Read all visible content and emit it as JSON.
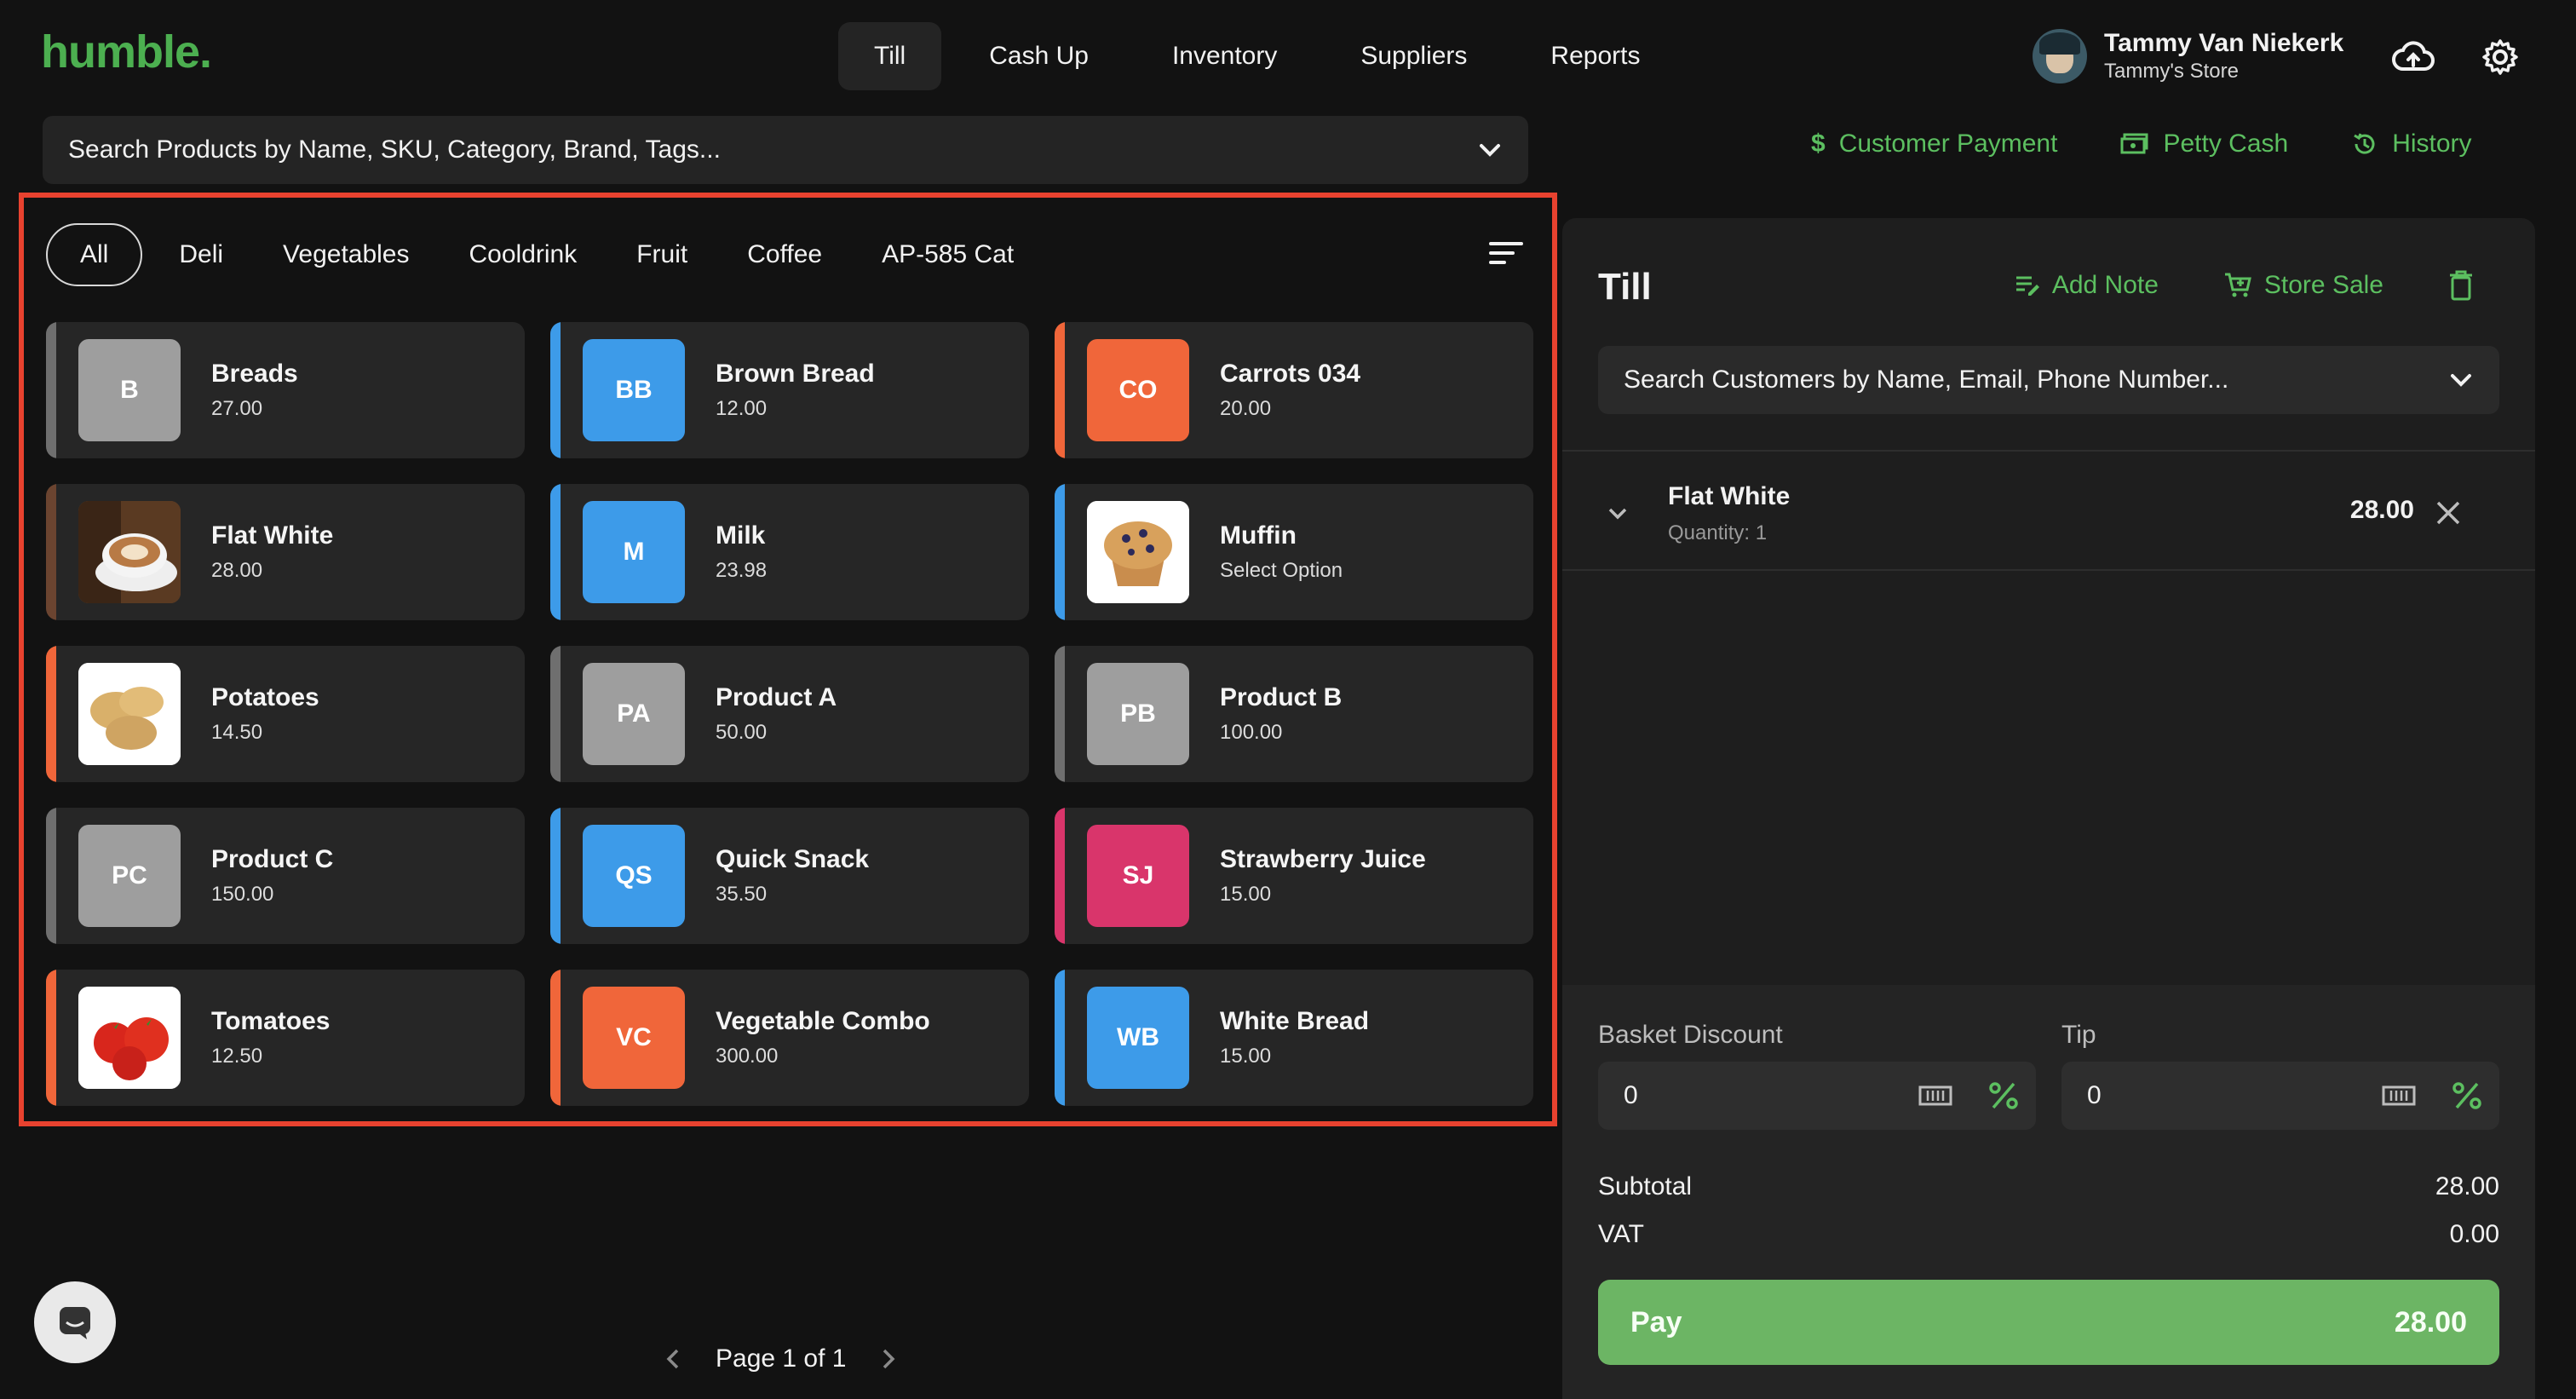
{
  "app": {
    "logo": "humble."
  },
  "nav": {
    "tabs": [
      "Till",
      "Cash Up",
      "Inventory",
      "Suppliers",
      "Reports"
    ],
    "active": "Till"
  },
  "user": {
    "name": "Tammy Van Niekerk",
    "store": "Tammy's Store"
  },
  "product_search": {
    "placeholder": "Search Products by Name, SKU, Category, Brand, Tags..."
  },
  "actions": {
    "customer_payment": "Customer Payment",
    "petty_cash": "Petty Cash",
    "history": "History"
  },
  "categories": [
    "All",
    "Deli",
    "Vegetables",
    "Cooldrink",
    "Fruit",
    "Coffee",
    "AP-585 Cat"
  ],
  "active_category": "All",
  "products": [
    {
      "initials": "B",
      "name": "Breads",
      "price": "27.00",
      "color": "#9e9e9e",
      "bar": "#6f6f6f",
      "icon": ""
    },
    {
      "initials": "BB",
      "name": "Brown Bread",
      "price": "12.00",
      "color": "#3d9be9",
      "bar": "#3d9be9",
      "icon": ""
    },
    {
      "initials": "CO",
      "name": "Carrots 034",
      "price": "20.00",
      "color": "#f0663a",
      "bar": "#f0663a",
      "icon": ""
    },
    {
      "initials": "",
      "name": "Flat White",
      "price": "28.00",
      "color": "#7a4a2a",
      "bar": "#6b4430",
      "icon": "coffee-cup-photo"
    },
    {
      "initials": "M",
      "name": "Milk",
      "price": "23.98",
      "color": "#3d9be9",
      "bar": "#3d9be9",
      "icon": ""
    },
    {
      "initials": "",
      "name": "Muffin",
      "price": "Select Option",
      "color": "#ffffff",
      "bar": "#3d9be9",
      "icon": "muffin-photo"
    },
    {
      "initials": "",
      "name": "Potatoes",
      "price": "14.50",
      "color": "#ffffff",
      "bar": "#f0663a",
      "icon": "potatoes-photo"
    },
    {
      "initials": "PA",
      "name": "Product A",
      "price": "50.00",
      "color": "#9e9e9e",
      "bar": "#6f6f6f",
      "icon": ""
    },
    {
      "initials": "PB",
      "name": "Product B",
      "price": "100.00",
      "color": "#9e9e9e",
      "bar": "#6f6f6f",
      "icon": ""
    },
    {
      "initials": "PC",
      "name": "Product C",
      "price": "150.00",
      "color": "#9e9e9e",
      "bar": "#6f6f6f",
      "icon": ""
    },
    {
      "initials": "QS",
      "name": "Quick Snack",
      "price": "35.50",
      "color": "#3d9be9",
      "bar": "#3d9be9",
      "icon": ""
    },
    {
      "initials": "SJ",
      "name": "Strawberry Juice",
      "price": "15.00",
      "color": "#d9356b",
      "bar": "#d9356b",
      "icon": ""
    },
    {
      "initials": "",
      "name": "Tomatoes",
      "price": "12.50",
      "color": "#ffffff",
      "bar": "#f0663a",
      "icon": "tomatoes-photo"
    },
    {
      "initials": "VC",
      "name": "Vegetable Combo",
      "price": "300.00",
      "color": "#f0663a",
      "bar": "#f0663a",
      "icon": ""
    },
    {
      "initials": "WB",
      "name": "White Bread",
      "price": "15.00",
      "color": "#3d9be9",
      "bar": "#3d9be9",
      "icon": ""
    }
  ],
  "pagination": {
    "label": "Page 1 of 1"
  },
  "till": {
    "title": "Till",
    "add_note": "Add Note",
    "store_sale": "Store Sale",
    "customer_search": {
      "placeholder": "Search Customers by Name, Email, Phone Number..."
    },
    "line_items": [
      {
        "name": "Flat White",
        "quantity": "Quantity: 1",
        "price": "28.00"
      }
    ],
    "basket_discount": {
      "label": "Basket Discount",
      "value": "0"
    },
    "tip": {
      "label": "Tip",
      "value": "0"
    },
    "subtotal": {
      "label": "Subtotal",
      "value": "28.00"
    },
    "vat": {
      "label": "VAT",
      "value": "0.00"
    },
    "pay": {
      "label": "Pay",
      "amount": "28.00"
    }
  },
  "colors": {
    "accent": "#5cbf60",
    "highlight_border": "#e8422f",
    "pay_button": "#6cb564"
  }
}
